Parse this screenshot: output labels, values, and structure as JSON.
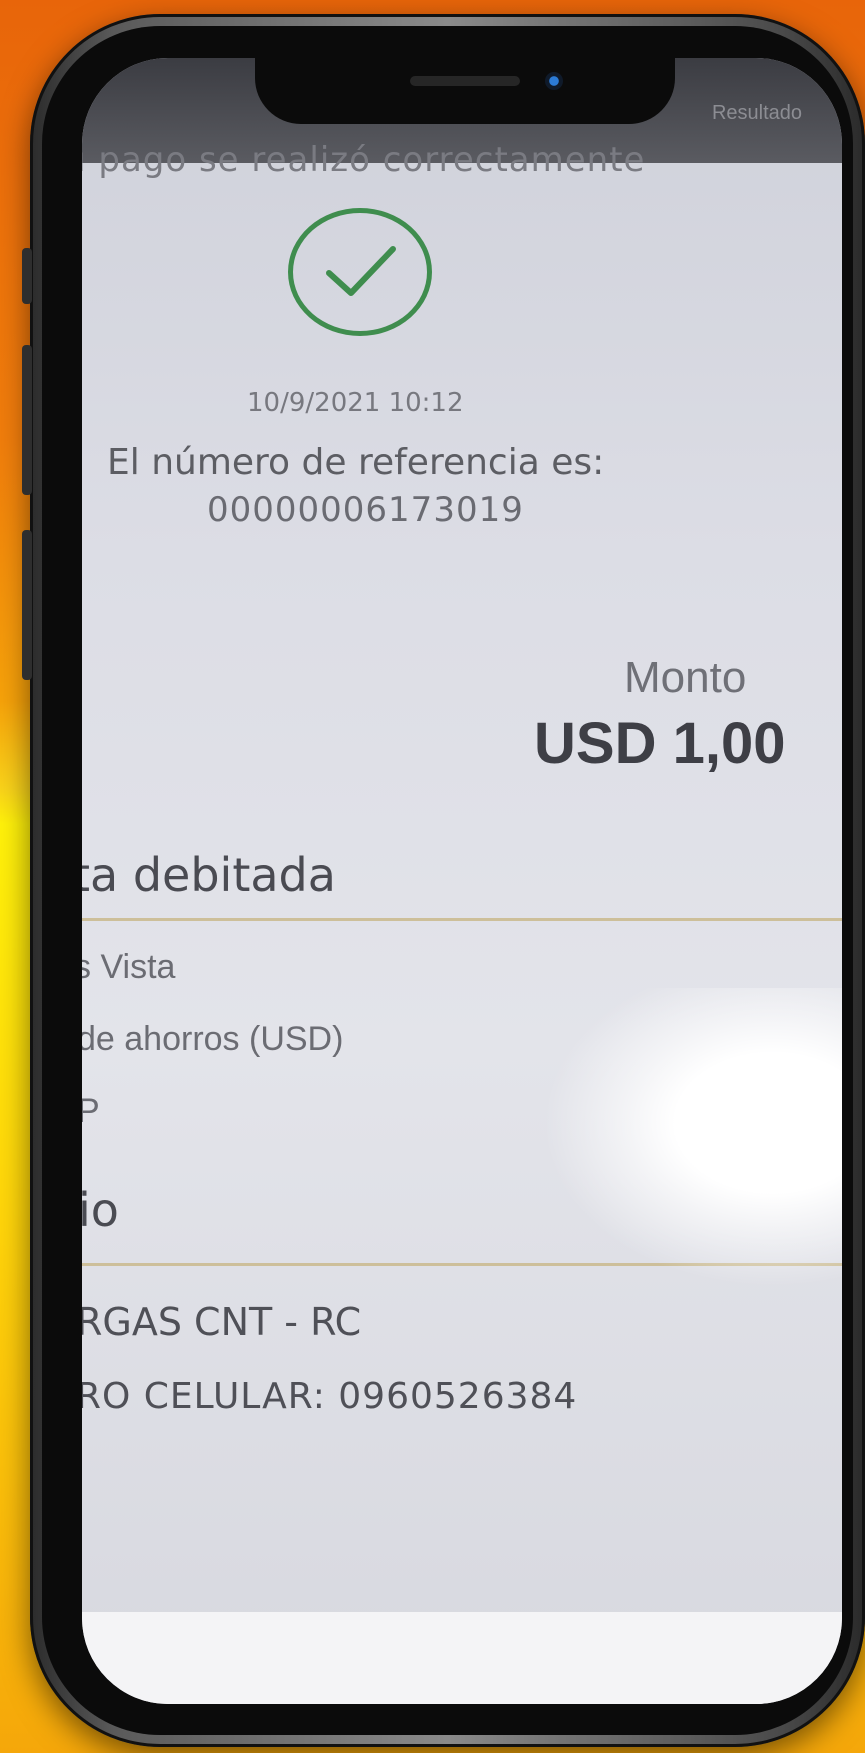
{
  "top_bar": {
    "label": "Resultado"
  },
  "payment": {
    "success_message": "u pago se realizó correctamente",
    "datetime": "10/9/2021 10:12",
    "reference_label": "El número de referencia es:",
    "reference_number": "00000006173019",
    "amount_label": "Monto",
    "amount_value": "USD 1,00"
  },
  "debited_account": {
    "title": "ta debitada",
    "name": "s Vista",
    "type": "de ahorros (USD)",
    "number": "P"
  },
  "service": {
    "title": "io",
    "name": "RGAS CNT - RC",
    "phone": "RO CELULAR: 0960526384"
  },
  "colors": {
    "success_green": "#3f8d4e",
    "background_orange": "#f07d0c",
    "background_yellow": "#fff10a"
  },
  "icons": {
    "check": "check-circle-icon"
  }
}
